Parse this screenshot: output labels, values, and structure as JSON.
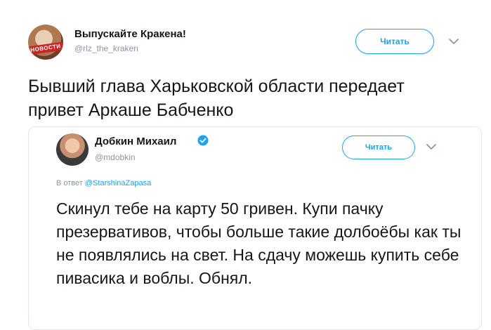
{
  "outer_tweet": {
    "author_name": "Выпускайте Кракена!",
    "author_handle": "@rlz_the_kraken",
    "avatar_label": "НОВОСТИ",
    "follow_label": "Читать",
    "text": "Бывший глава Харьковской области передает привет Аркаше Бабченко"
  },
  "quoted_tweet": {
    "author_name": "Добкин Михаил",
    "author_handle": "@mdobkin",
    "follow_label": "Читать",
    "reply_prefix": "В ответ",
    "reply_to": "@StarshinaZapasa",
    "text": "Скинул тебе на карту 50 гривен. Купи пачку презервативов, чтобы больше такие долбоёбы как ты не появлялись на свет. На сдачу можешь купить себе пивасика и воблы. Обнял."
  },
  "colors": {
    "accent": "#1da1f2",
    "text": "#14171a",
    "muted": "#8a96a3",
    "border": "#e1e8ed"
  },
  "icons": [
    "chevron-down-icon",
    "verified-badge-icon"
  ]
}
